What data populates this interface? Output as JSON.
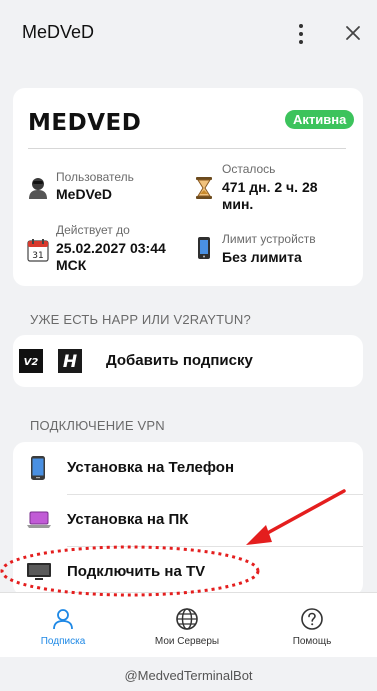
{
  "app": {
    "title": "MeDVeD"
  },
  "subscription": {
    "name": "MEDVED",
    "status": "Активна",
    "status_color": "#3cc35c",
    "user_label": "Пользователь",
    "user_value": "MeDVeD",
    "remaining_label": "Осталось",
    "remaining_value_1": "471 дн. 2 ч. 28",
    "remaining_value_2": "мин.",
    "valid_label": "Действует до",
    "valid_value_1": "25.02.2027 03:44",
    "valid_value_2": "МСК",
    "calendar_day": "31",
    "limit_label": "Лимит устройств",
    "limit_value": "Без лимита"
  },
  "happ_section": {
    "title": "УЖЕ ЕСТЬ HAPP ИЛИ V2RAYTUN?",
    "add_label": "Добавить подписку",
    "v2_icon_text": "V2",
    "happ_icon_text": "H"
  },
  "vpn_section": {
    "title": "ПОДКЛЮЧЕНИЕ VPN",
    "items": [
      {
        "label": "Установка на Телефон",
        "icon": "phone-icon"
      },
      {
        "label": "Установка на ПК",
        "icon": "laptop-icon"
      },
      {
        "label": "Подключить на TV",
        "icon": "tv-icon"
      }
    ]
  },
  "nav": {
    "items": [
      {
        "label": "Подписка",
        "icon": "user-icon",
        "active": true
      },
      {
        "label": "Мои Серверы",
        "icon": "globe-icon",
        "active": false
      },
      {
        "label": "Помощь",
        "icon": "help-icon",
        "active": false
      }
    ],
    "active_color": "#1e88e5"
  },
  "footer": {
    "text": "@MedvedTerminalBot"
  },
  "annotation": {
    "color": "#e41e1e"
  }
}
